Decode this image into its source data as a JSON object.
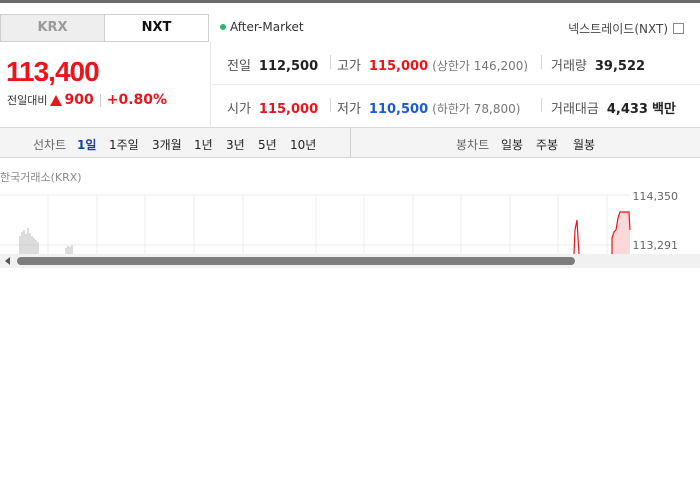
{
  "tabs": [
    "KRX",
    "NXT"
  ],
  "session": "After-Market",
  "exchange_link": "넥스트레이드(NXT)",
  "price": {
    "current": "113,400",
    "change_label": "전일대비",
    "change_abs": "900",
    "change_pct": "+0.80%",
    "direction": "up"
  },
  "stats": {
    "prev_close": {
      "label": "전일",
      "value": "112,500"
    },
    "high": {
      "label": "고가",
      "value": "115,000",
      "sub": "(상한가 146,200)"
    },
    "volume": {
      "label": "거래량",
      "value": "39,522"
    },
    "open": {
      "label": "시가",
      "value": "115,000"
    },
    "low": {
      "label": "저가",
      "value": "110,500",
      "sub": "(하한가 78,800)"
    },
    "trade_value": {
      "label": "거래대금",
      "value": "4,433",
      "unit": "백만"
    }
  },
  "toolbar": {
    "line_label": "선차트",
    "line_periods": [
      "1일",
      "1주일",
      "3개월",
      "1년",
      "3년",
      "5년",
      "10년"
    ],
    "active_period": "1일",
    "candle_label": "봉차트",
    "candle_periods": [
      "일봉",
      "주봉",
      "월봉"
    ]
  },
  "chart": {
    "source": "한국거래소(KRX)",
    "y_ticks": [
      "114,350",
      "113,291"
    ]
  },
  "chart_data": {
    "type": "line",
    "title": "",
    "y_ticks": [
      114350,
      113291
    ],
    "series_color": "#e8151b",
    "volume_color": "#b8b8b8"
  },
  "colors": {
    "up": "#e8151b",
    "down": "#1a5ccf",
    "active": "#1a3fa8",
    "session_dot": "#2bb673"
  }
}
